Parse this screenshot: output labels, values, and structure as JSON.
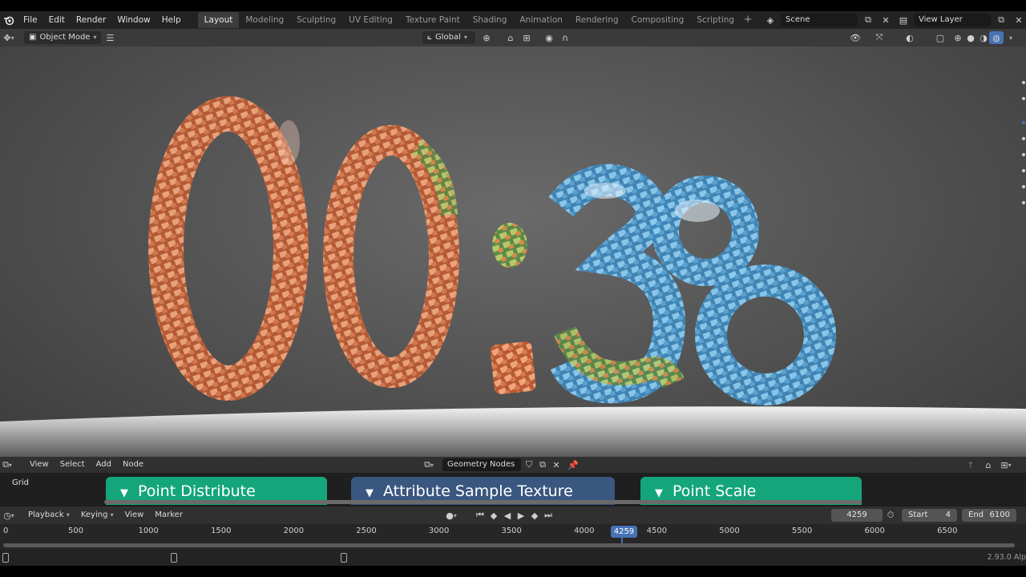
{
  "menu": [
    "File",
    "Edit",
    "Render",
    "Window",
    "Help"
  ],
  "workspace_tabs": [
    "Layout",
    "Modeling",
    "Sculpting",
    "UV Editing",
    "Texture Paint",
    "Shading",
    "Animation",
    "Rendering",
    "Compositing",
    "Scripting"
  ],
  "active_tab": "Layout",
  "scene_name": "Scene",
  "view_layer": "View Layer",
  "viewport_header": {
    "mode": "Object Mode",
    "orientation": "Global"
  },
  "viewport_content": {
    "text_display": "00:38",
    "colors": {
      "copper": "#e58a5e",
      "blue": "#6fb4e0",
      "green": "#8db05a"
    }
  },
  "node_editor": {
    "menus": [
      "View",
      "Select",
      "Add",
      "Node"
    ],
    "tree_name": "Geometry Nodes",
    "area_label": "Grid",
    "nodes": [
      {
        "title": "Point Distribute",
        "color": "#15a57a"
      },
      {
        "title": "Attribute Sample Texture",
        "color": "#39577f"
      },
      {
        "title": "Point Scale",
        "color": "#15a57a"
      }
    ]
  },
  "timeline": {
    "menus": [
      "Playback",
      "Keying",
      "View",
      "Marker"
    ],
    "current_frame": "4259",
    "start_label": "Start",
    "start_value": "4",
    "end_label": "End",
    "end_value": "6100",
    "ticks": [
      "0",
      "500",
      "1000",
      "1500",
      "2000",
      "2500",
      "3000",
      "3500",
      "4000",
      "4500",
      "5000",
      "5500",
      "6000",
      "6500"
    ],
    "playhead_frame": 4259
  },
  "status": {
    "version": "2.93.0 Alp"
  }
}
